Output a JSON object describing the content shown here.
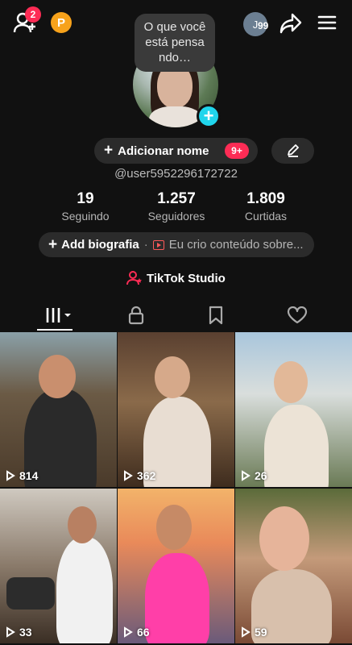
{
  "header": {
    "notification_count": "2",
    "promo_letter": "P",
    "account_initial": "J",
    "account_count": "99"
  },
  "profile": {
    "thought_bubble": "O que você está pensa ndo…",
    "add_name_label": "Adicionar nome",
    "name_badge": "9+",
    "username": "@user5952296172722"
  },
  "stats": [
    {
      "value": "19",
      "label": "Seguindo"
    },
    {
      "value": "1.257",
      "label": "Seguidores"
    },
    {
      "value": "1.809",
      "label": "Curtidas"
    }
  ],
  "bio": {
    "add_label": "Add biografia",
    "separator": "·",
    "hint": "Eu crio conteúdo sobre..."
  },
  "studio": {
    "label": "TikTok Studio"
  },
  "tabs": [
    "videos-grid",
    "private-lock",
    "saved-bookmark",
    "liked-heart"
  ],
  "videos": [
    {
      "views": "814"
    },
    {
      "views": "362"
    },
    {
      "views": "26"
    },
    {
      "views": "33"
    },
    {
      "views": "66"
    },
    {
      "views": "59"
    }
  ],
  "colors": {
    "background": "#111111",
    "accent": "#fe2c55",
    "plus": "#20d5ec",
    "pill": "#2b2b2b"
  }
}
